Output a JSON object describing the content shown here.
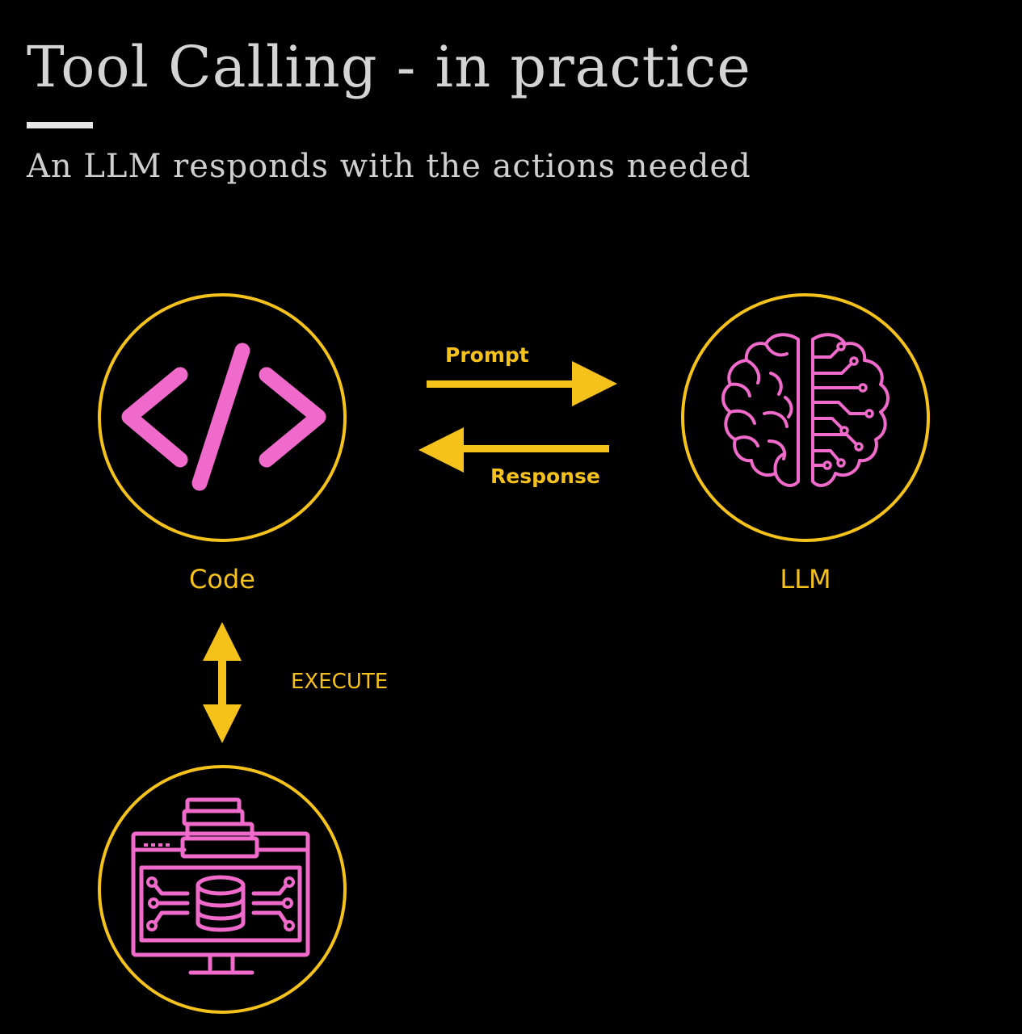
{
  "slide": {
    "title": "Tool Calling - in practice",
    "subtitle": "An LLM responds with the actions needed"
  },
  "nodes": {
    "code": {
      "label": "Code",
      "icon": "code-brackets-icon"
    },
    "llm": {
      "label": "LLM",
      "icon": "brain-circuit-icon"
    },
    "tools": {
      "icon": "database-monitor-icon"
    }
  },
  "edges": {
    "prompt": {
      "label": "Prompt",
      "direction": "code-to-llm"
    },
    "response": {
      "label": "Response",
      "direction": "llm-to-code"
    },
    "execute": {
      "label": "EXECUTE",
      "direction": "bidirectional"
    }
  },
  "colors": {
    "background": "#000000",
    "accent_yellow": "#f5c21b",
    "icon_pink": "#f06acb",
    "title_text": "#d4d4d4"
  }
}
